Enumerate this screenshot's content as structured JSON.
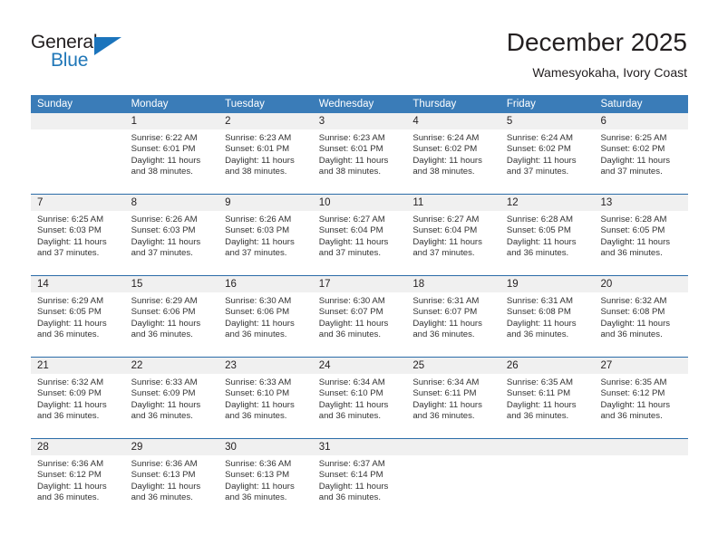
{
  "brand": {
    "name_top": "General",
    "name_bottom": "Blue",
    "color_dark": "#231f20",
    "color_blue": "#2077b8",
    "triangle_color": "#1b74bc"
  },
  "header": {
    "title": "December 2025",
    "subtitle": "Wamesyokaha, Ivory Coast"
  },
  "theme": {
    "header_bg": "#3a7cb8",
    "header_text": "#ffffff",
    "daynum_bg": "#f0f0f0",
    "week_divider": "#2b6ca8",
    "body_text": "#333333"
  },
  "weekdays": [
    "Sunday",
    "Monday",
    "Tuesday",
    "Wednesday",
    "Thursday",
    "Friday",
    "Saturday"
  ],
  "weeks": [
    {
      "days": [
        {
          "num": "",
          "sunrise": "",
          "sunset": "",
          "daylight_1": "",
          "daylight_2": "",
          "empty": true
        },
        {
          "num": "1",
          "sunrise": "Sunrise: 6:22 AM",
          "sunset": "Sunset: 6:01 PM",
          "daylight_1": "Daylight: 11 hours",
          "daylight_2": "and 38 minutes."
        },
        {
          "num": "2",
          "sunrise": "Sunrise: 6:23 AM",
          "sunset": "Sunset: 6:01 PM",
          "daylight_1": "Daylight: 11 hours",
          "daylight_2": "and 38 minutes."
        },
        {
          "num": "3",
          "sunrise": "Sunrise: 6:23 AM",
          "sunset": "Sunset: 6:01 PM",
          "daylight_1": "Daylight: 11 hours",
          "daylight_2": "and 38 minutes."
        },
        {
          "num": "4",
          "sunrise": "Sunrise: 6:24 AM",
          "sunset": "Sunset: 6:02 PM",
          "daylight_1": "Daylight: 11 hours",
          "daylight_2": "and 38 minutes."
        },
        {
          "num": "5",
          "sunrise": "Sunrise: 6:24 AM",
          "sunset": "Sunset: 6:02 PM",
          "daylight_1": "Daylight: 11 hours",
          "daylight_2": "and 37 minutes."
        },
        {
          "num": "6",
          "sunrise": "Sunrise: 6:25 AM",
          "sunset": "Sunset: 6:02 PM",
          "daylight_1": "Daylight: 11 hours",
          "daylight_2": "and 37 minutes."
        }
      ]
    },
    {
      "days": [
        {
          "num": "7",
          "sunrise": "Sunrise: 6:25 AM",
          "sunset": "Sunset: 6:03 PM",
          "daylight_1": "Daylight: 11 hours",
          "daylight_2": "and 37 minutes."
        },
        {
          "num": "8",
          "sunrise": "Sunrise: 6:26 AM",
          "sunset": "Sunset: 6:03 PM",
          "daylight_1": "Daylight: 11 hours",
          "daylight_2": "and 37 minutes."
        },
        {
          "num": "9",
          "sunrise": "Sunrise: 6:26 AM",
          "sunset": "Sunset: 6:03 PM",
          "daylight_1": "Daylight: 11 hours",
          "daylight_2": "and 37 minutes."
        },
        {
          "num": "10",
          "sunrise": "Sunrise: 6:27 AM",
          "sunset": "Sunset: 6:04 PM",
          "daylight_1": "Daylight: 11 hours",
          "daylight_2": "and 37 minutes."
        },
        {
          "num": "11",
          "sunrise": "Sunrise: 6:27 AM",
          "sunset": "Sunset: 6:04 PM",
          "daylight_1": "Daylight: 11 hours",
          "daylight_2": "and 37 minutes."
        },
        {
          "num": "12",
          "sunrise": "Sunrise: 6:28 AM",
          "sunset": "Sunset: 6:05 PM",
          "daylight_1": "Daylight: 11 hours",
          "daylight_2": "and 36 minutes."
        },
        {
          "num": "13",
          "sunrise": "Sunrise: 6:28 AM",
          "sunset": "Sunset: 6:05 PM",
          "daylight_1": "Daylight: 11 hours",
          "daylight_2": "and 36 minutes."
        }
      ]
    },
    {
      "days": [
        {
          "num": "14",
          "sunrise": "Sunrise: 6:29 AM",
          "sunset": "Sunset: 6:05 PM",
          "daylight_1": "Daylight: 11 hours",
          "daylight_2": "and 36 minutes."
        },
        {
          "num": "15",
          "sunrise": "Sunrise: 6:29 AM",
          "sunset": "Sunset: 6:06 PM",
          "daylight_1": "Daylight: 11 hours",
          "daylight_2": "and 36 minutes."
        },
        {
          "num": "16",
          "sunrise": "Sunrise: 6:30 AM",
          "sunset": "Sunset: 6:06 PM",
          "daylight_1": "Daylight: 11 hours",
          "daylight_2": "and 36 minutes."
        },
        {
          "num": "17",
          "sunrise": "Sunrise: 6:30 AM",
          "sunset": "Sunset: 6:07 PM",
          "daylight_1": "Daylight: 11 hours",
          "daylight_2": "and 36 minutes."
        },
        {
          "num": "18",
          "sunrise": "Sunrise: 6:31 AM",
          "sunset": "Sunset: 6:07 PM",
          "daylight_1": "Daylight: 11 hours",
          "daylight_2": "and 36 minutes."
        },
        {
          "num": "19",
          "sunrise": "Sunrise: 6:31 AM",
          "sunset": "Sunset: 6:08 PM",
          "daylight_1": "Daylight: 11 hours",
          "daylight_2": "and 36 minutes."
        },
        {
          "num": "20",
          "sunrise": "Sunrise: 6:32 AM",
          "sunset": "Sunset: 6:08 PM",
          "daylight_1": "Daylight: 11 hours",
          "daylight_2": "and 36 minutes."
        }
      ]
    },
    {
      "days": [
        {
          "num": "21",
          "sunrise": "Sunrise: 6:32 AM",
          "sunset": "Sunset: 6:09 PM",
          "daylight_1": "Daylight: 11 hours",
          "daylight_2": "and 36 minutes."
        },
        {
          "num": "22",
          "sunrise": "Sunrise: 6:33 AM",
          "sunset": "Sunset: 6:09 PM",
          "daylight_1": "Daylight: 11 hours",
          "daylight_2": "and 36 minutes."
        },
        {
          "num": "23",
          "sunrise": "Sunrise: 6:33 AM",
          "sunset": "Sunset: 6:10 PM",
          "daylight_1": "Daylight: 11 hours",
          "daylight_2": "and 36 minutes."
        },
        {
          "num": "24",
          "sunrise": "Sunrise: 6:34 AM",
          "sunset": "Sunset: 6:10 PM",
          "daylight_1": "Daylight: 11 hours",
          "daylight_2": "and 36 minutes."
        },
        {
          "num": "25",
          "sunrise": "Sunrise: 6:34 AM",
          "sunset": "Sunset: 6:11 PM",
          "daylight_1": "Daylight: 11 hours",
          "daylight_2": "and 36 minutes."
        },
        {
          "num": "26",
          "sunrise": "Sunrise: 6:35 AM",
          "sunset": "Sunset: 6:11 PM",
          "daylight_1": "Daylight: 11 hours",
          "daylight_2": "and 36 minutes."
        },
        {
          "num": "27",
          "sunrise": "Sunrise: 6:35 AM",
          "sunset": "Sunset: 6:12 PM",
          "daylight_1": "Daylight: 11 hours",
          "daylight_2": "and 36 minutes."
        }
      ]
    },
    {
      "days": [
        {
          "num": "28",
          "sunrise": "Sunrise: 6:36 AM",
          "sunset": "Sunset: 6:12 PM",
          "daylight_1": "Daylight: 11 hours",
          "daylight_2": "and 36 minutes."
        },
        {
          "num": "29",
          "sunrise": "Sunrise: 6:36 AM",
          "sunset": "Sunset: 6:13 PM",
          "daylight_1": "Daylight: 11 hours",
          "daylight_2": "and 36 minutes."
        },
        {
          "num": "30",
          "sunrise": "Sunrise: 6:36 AM",
          "sunset": "Sunset: 6:13 PM",
          "daylight_1": "Daylight: 11 hours",
          "daylight_2": "and 36 minutes."
        },
        {
          "num": "31",
          "sunrise": "Sunrise: 6:37 AM",
          "sunset": "Sunset: 6:14 PM",
          "daylight_1": "Daylight: 11 hours",
          "daylight_2": "and 36 minutes."
        },
        {
          "num": "",
          "sunrise": "",
          "sunset": "",
          "daylight_1": "",
          "daylight_2": "",
          "empty": true
        },
        {
          "num": "",
          "sunrise": "",
          "sunset": "",
          "daylight_1": "",
          "daylight_2": "",
          "empty": true
        },
        {
          "num": "",
          "sunrise": "",
          "sunset": "",
          "daylight_1": "",
          "daylight_2": "",
          "empty": true
        }
      ]
    }
  ]
}
